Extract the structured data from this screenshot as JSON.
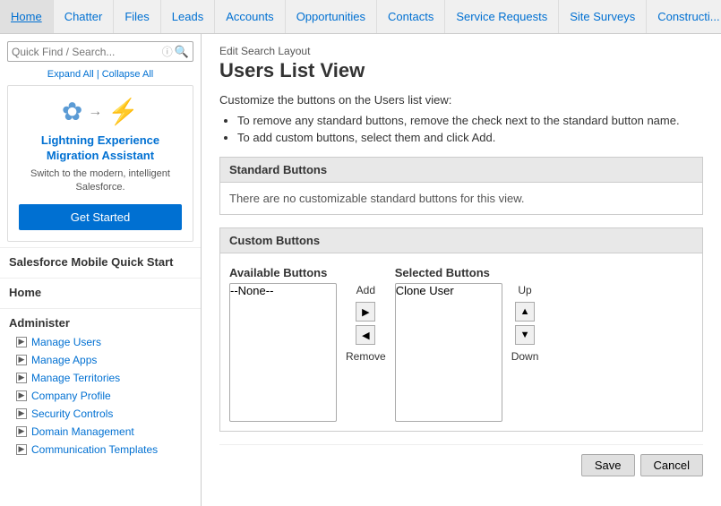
{
  "nav": {
    "items": [
      "Home",
      "Chatter",
      "Files",
      "Leads",
      "Accounts",
      "Opportunities",
      "Contacts",
      "Service Requests",
      "Site Surveys",
      "Constructi..."
    ]
  },
  "sidebar": {
    "search_placeholder": "Quick Find / Search...",
    "expand_label": "Expand All",
    "collapse_label": "Collapse All",
    "migration": {
      "title": "Lightning Experience Migration Assistant",
      "description": "Switch to the modern, intelligent Salesforce.",
      "button_label": "Get Started"
    },
    "quick_start_label": "Salesforce Mobile Quick Start",
    "home_label": "Home",
    "administer_label": "Administer",
    "links": [
      "Manage Users",
      "Manage Apps",
      "Manage Territories",
      "Company Profile",
      "Security Controls",
      "Domain Management",
      "Communication Templates"
    ]
  },
  "main": {
    "breadcrumb": "Edit Search Layout",
    "title": "Users List View",
    "description": "Customize the buttons on the Users list view:",
    "bullets": [
      "To remove any standard buttons, remove the check next to the standard button name.",
      "To add custom buttons, select them and click Add."
    ],
    "standard_buttons": {
      "header": "Standard Buttons",
      "empty_text": "There are no customizable standard buttons for this view."
    },
    "custom_buttons": {
      "header": "Custom Buttons",
      "available_label": "Available Buttons",
      "selected_label": "Selected Buttons",
      "available_items": [
        "--None--"
      ],
      "selected_items": [
        "Clone User"
      ],
      "add_label": "Add",
      "remove_label": "Remove",
      "up_label": "Up",
      "down_label": "Down"
    },
    "actions": {
      "save_label": "Save",
      "cancel_label": "Cancel"
    }
  }
}
